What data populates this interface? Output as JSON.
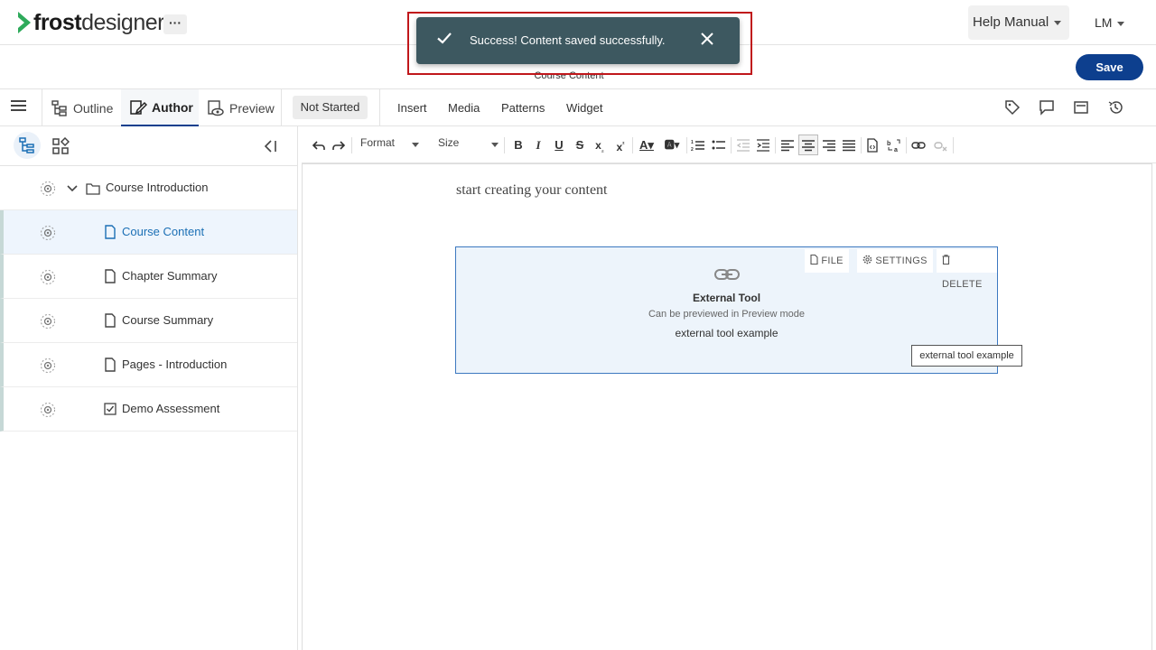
{
  "app": {
    "logo_bold": "frost",
    "logo_light": "designer",
    "more_label": "···"
  },
  "header": {
    "help_label": "Help Manual",
    "user_initials": "LM",
    "subtitle": "Course Content",
    "save_label": "Save"
  },
  "toast": {
    "message": "Success! Content saved successfully."
  },
  "tabs": [
    {
      "label": "Outline"
    },
    {
      "label": "Author"
    },
    {
      "label": "Preview"
    }
  ],
  "status": "Not Started",
  "menu": [
    "Insert",
    "Media",
    "Patterns",
    "Widget"
  ],
  "sidebar": {
    "items": [
      {
        "label": "Course Introduction"
      },
      {
        "label": "Course Content"
      },
      {
        "label": "Chapter Summary"
      },
      {
        "label": "Course Summary"
      },
      {
        "label": "Pages - Introduction"
      },
      {
        "label": "Demo Assessment"
      }
    ]
  },
  "toolbar": {
    "format_label": "Format",
    "size_label": "Size"
  },
  "editor": {
    "placeholder_text": "start creating your content",
    "external_tool": {
      "file_label": "FILE",
      "settings_label": "SETTINGS",
      "delete_label": "DELETE",
      "title": "External Tool",
      "subtitle": "Can be previewed in Preview mode",
      "name": "external tool example"
    },
    "tooltip": "external tool example"
  },
  "colors": {
    "brand_green": "#2eaa5b",
    "primary": "#0d3f8e",
    "toast_bg": "#3d5860",
    "highlight_outline": "#c0171b",
    "selected_text": "#1b6fb5"
  }
}
